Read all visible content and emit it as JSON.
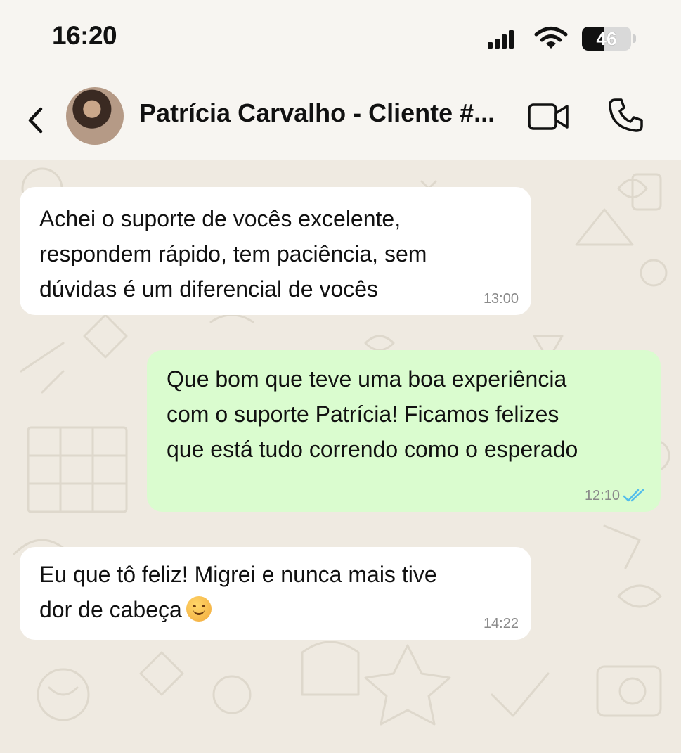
{
  "status_bar": {
    "time": "16:20",
    "battery": 46,
    "battery_label": "46"
  },
  "header": {
    "contact_name": "Patrícia Carvalho - Cliente #...",
    "icons": [
      "back-chevron-icon",
      "avatar",
      "video-call-icon",
      "phone-call-icon"
    ]
  },
  "messages": [
    {
      "direction": "incoming",
      "text": "Achei o suporte de vocês excelente,\nrespondem rápido, tem paciência, sem\ndúvidas é um diferencial de vocês",
      "time": "13:00"
    },
    {
      "direction": "outgoing",
      "text": "Que bom que teve uma boa experiência\ncom o suporte Patrícia! Ficamos felizes\nque está tudo correndo como o esperado",
      "time": "12:10",
      "status": "read"
    },
    {
      "direction": "incoming",
      "text_line1": "Eu que tô feliz! Migrei e nunca mais tive",
      "text_line2": "dor de cabeça",
      "emoji": "smiling-face",
      "time": "14:22"
    }
  ],
  "colors": {
    "incoming_bubble": "#ffffff",
    "outgoing_bubble": "#dafccf",
    "chat_background": "#efeae1",
    "read_ticks": "#53bdeb"
  }
}
